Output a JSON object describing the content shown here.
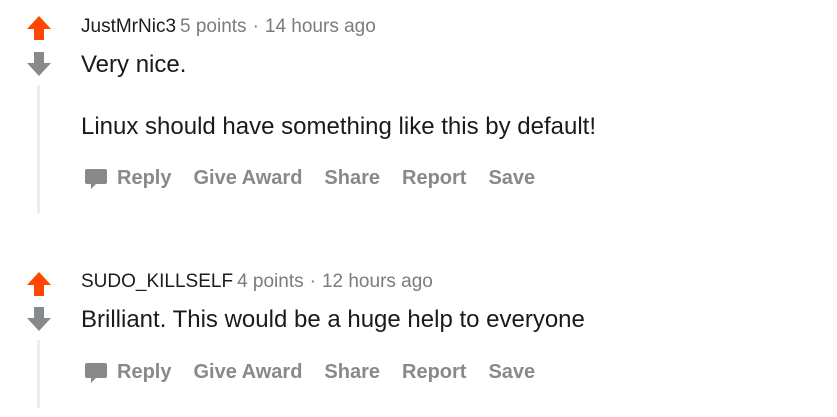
{
  "comments": [
    {
      "author": "JustMrNic3",
      "points": "5 points",
      "separator": "·",
      "time": "14 hours ago",
      "paragraphs": [
        "Very nice.",
        "Linux should have something like this by default!"
      ]
    },
    {
      "author": "SUDO_KILLSELF",
      "points": "4 points",
      "separator": "·",
      "time": "12 hours ago",
      "paragraphs": [
        "Brilliant. This would be a huge help to everyone"
      ]
    }
  ],
  "actions": {
    "reply": "Reply",
    "give_award": "Give Award",
    "share": "Share",
    "report": "Report",
    "save": "Save"
  },
  "icons": {
    "upvote": "arrow-up-icon",
    "downvote": "arrow-down-icon",
    "reply": "speech-bubble-icon"
  },
  "colors": {
    "upvote": "#ff4500",
    "downvote": "#878a8c",
    "meta": "#7c7c7c",
    "action": "#878a8c",
    "thread_line": "#ededed"
  }
}
